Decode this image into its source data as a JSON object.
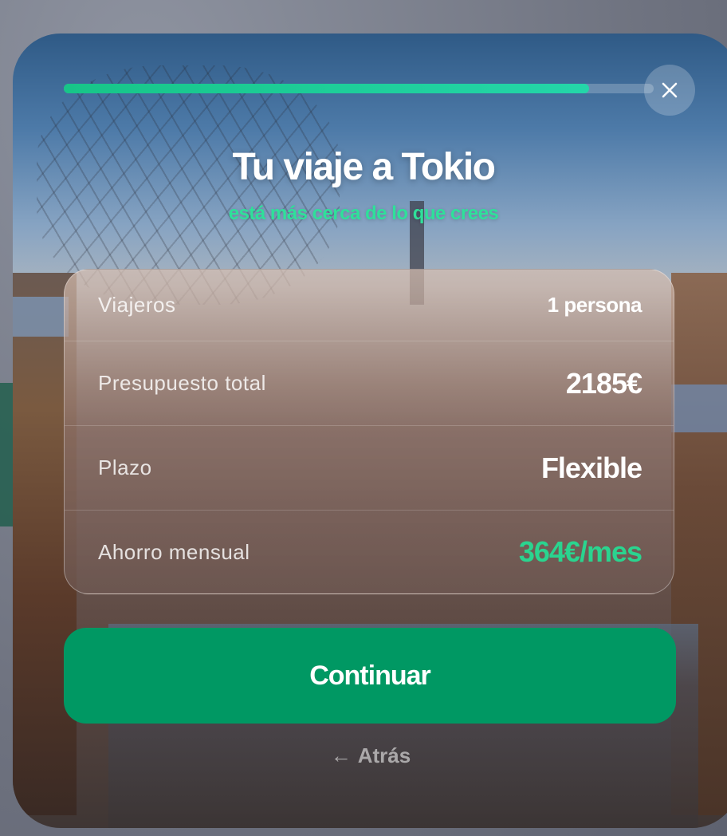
{
  "progress": {
    "fraction": 0.89
  },
  "close": {
    "icon": "close-icon"
  },
  "header": {
    "title": "Tu viaje a Tokio",
    "subtitle": "está más cerca de lo que crees"
  },
  "summary": {
    "rows": [
      {
        "label": "Viajeros",
        "value": "1 persona"
      },
      {
        "label": "Presupuesto total",
        "value": "2185€"
      },
      {
        "label": "Plazo",
        "value": "Flexible"
      },
      {
        "label": "Ahorro mensual",
        "value": "364€/mes"
      }
    ]
  },
  "actions": {
    "continue_label": "Continuar",
    "back_arrow": "←",
    "back_label": "Atrás"
  },
  "colors": {
    "accent": "#009863",
    "highlight": "#2ad48f"
  }
}
